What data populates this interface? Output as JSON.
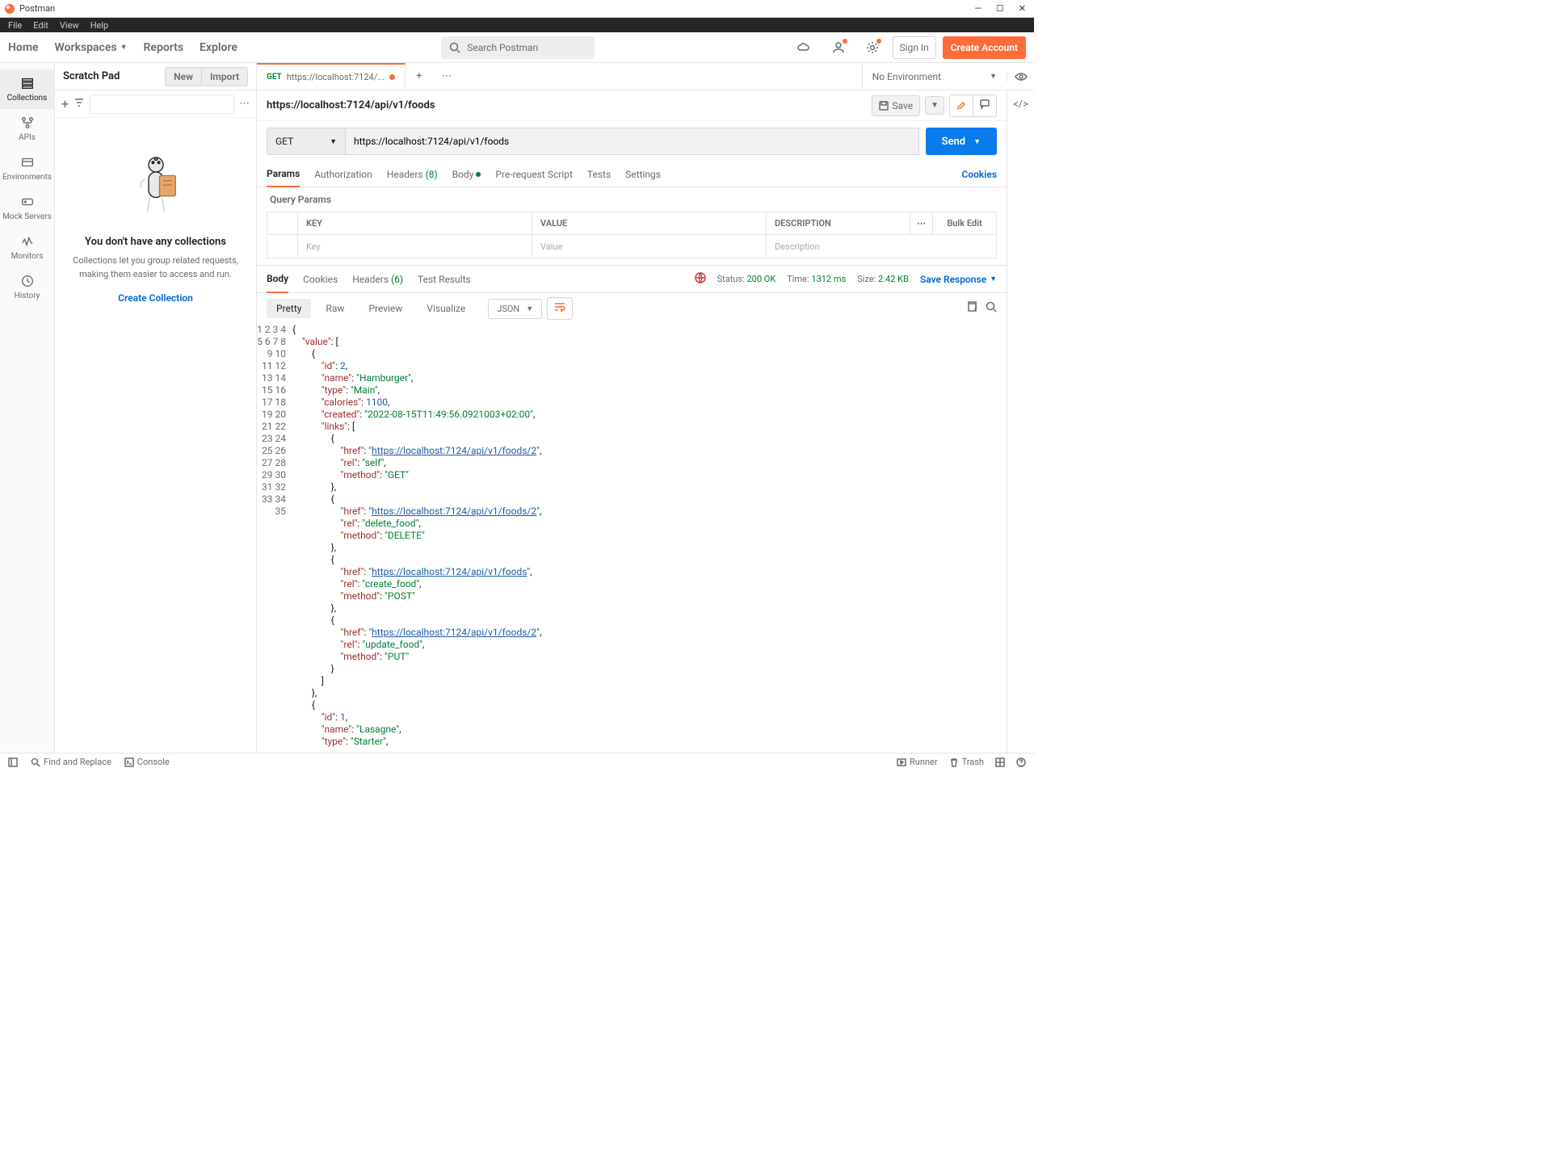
{
  "app": {
    "title": "Postman"
  },
  "menubar": [
    "File",
    "Edit",
    "View",
    "Help"
  ],
  "header": {
    "nav": [
      "Home",
      "Workspaces",
      "Reports",
      "Explore"
    ],
    "search_placeholder": "Search Postman",
    "signin": "Sign In",
    "create_account": "Create Account"
  },
  "sidebar_rail": [
    {
      "label": "Collections",
      "active": true
    },
    {
      "label": "APIs",
      "active": false
    },
    {
      "label": "Environments",
      "active": false
    },
    {
      "label": "Mock Servers",
      "active": false
    },
    {
      "label": "Monitors",
      "active": false
    },
    {
      "label": "History",
      "active": false
    }
  ],
  "sidebar": {
    "title": "Scratch Pad",
    "new": "New",
    "import": "Import",
    "empty_title": "You don't have any collections",
    "empty_body": "Collections let you group related requests, making them easier to access and run.",
    "empty_cta": "Create Collection"
  },
  "tabs": {
    "active": {
      "method": "GET",
      "label": "https://localhost:7124/..."
    },
    "env": "No Environment"
  },
  "request": {
    "title": "https://localhost:7124/api/v1/foods",
    "save": "Save",
    "method": "GET",
    "url": "https://localhost:7124/api/v1/foods",
    "send": "Send",
    "tabs": {
      "params": "Params",
      "auth": "Authorization",
      "headers": "Headers",
      "headers_count": "(8)",
      "body": "Body",
      "prereq": "Pre-request Script",
      "tests": "Tests",
      "settings": "Settings"
    },
    "cookies": "Cookies",
    "query_params": "Query Params",
    "table": {
      "key": "KEY",
      "value": "VALUE",
      "desc": "DESCRIPTION",
      "bulk": "Bulk Edit",
      "ph_key": "Key",
      "ph_value": "Value",
      "ph_desc": "Description"
    }
  },
  "response": {
    "tabs": {
      "body": "Body",
      "cookies": "Cookies",
      "headers": "Headers",
      "headers_count": "(6)",
      "tests": "Test Results"
    },
    "status_lbl": "Status:",
    "status_val": "200 OK",
    "time_lbl": "Time:",
    "time_val": "1312 ms",
    "size_lbl": "Size:",
    "size_val": "2.42 KB",
    "save": "Save Response",
    "views": {
      "pretty": "Pretty",
      "raw": "Raw",
      "preview": "Preview",
      "visualize": "Visualize"
    },
    "format": "JSON"
  },
  "json_body": {
    "value": [
      {
        "id": 2,
        "name": "Hamburger",
        "type": "Main",
        "calories": 1100,
        "created": "2022-08-15T11:49:56.0921003+02:00",
        "links": [
          {
            "href": "https://localhost:7124/api/v1/foods/2",
            "rel": "self",
            "method": "GET"
          },
          {
            "href": "https://localhost:7124/api/v1/foods/2",
            "rel": "delete_food",
            "method": "DELETE"
          },
          {
            "href": "https://localhost:7124/api/v1/foods",
            "rel": "create_food",
            "method": "POST"
          },
          {
            "href": "https://localhost:7124/api/v1/foods/2",
            "rel": "update_food",
            "method": "PUT"
          }
        ]
      },
      {
        "id": 1,
        "name": "Lasagne",
        "type": "Starter"
      }
    ]
  },
  "statusbar": {
    "find": "Find and Replace",
    "console": "Console",
    "runner": "Runner",
    "trash": "Trash"
  }
}
